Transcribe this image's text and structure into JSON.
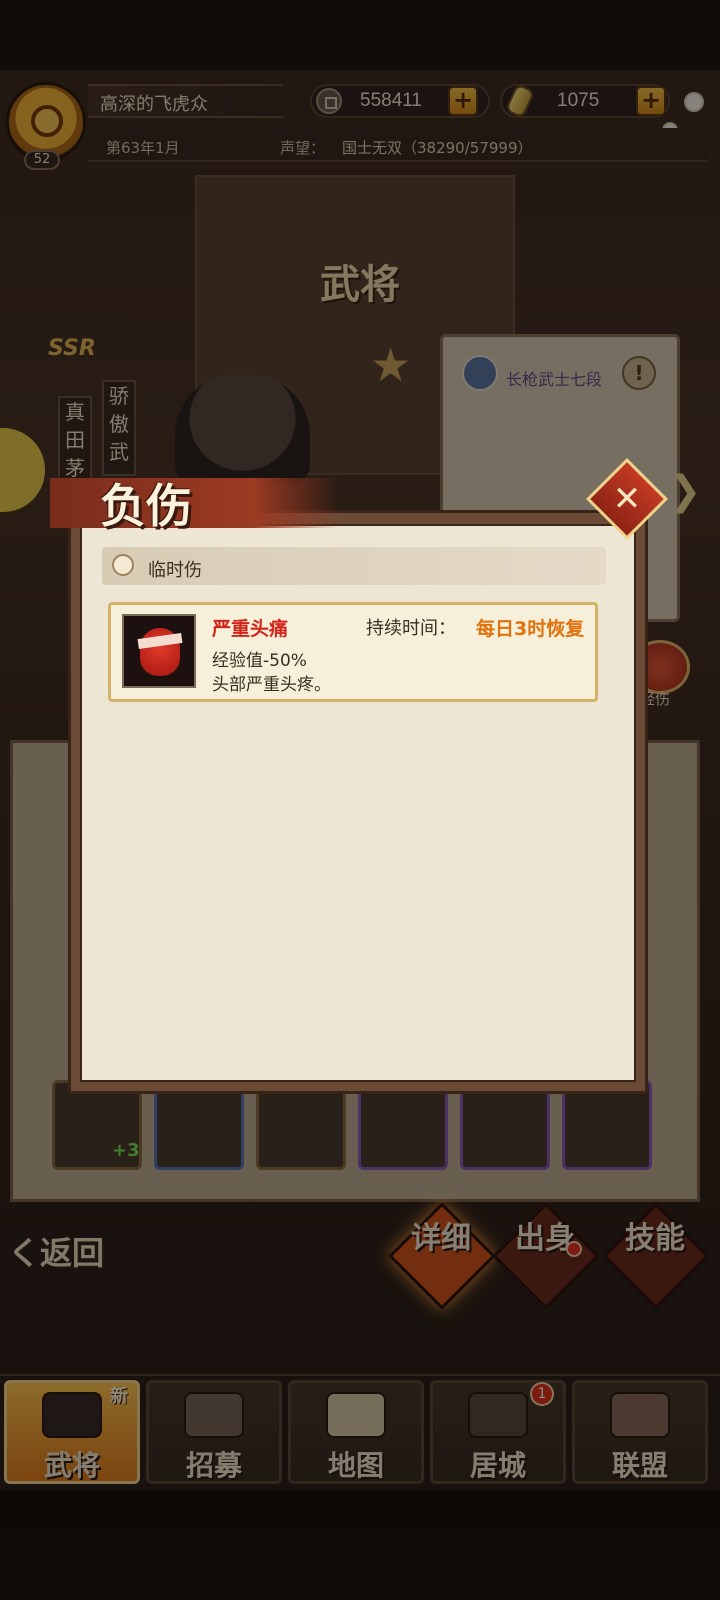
{
  "player": {
    "name": "高深的飞虎众",
    "level": "52",
    "date": "第63年1月",
    "reputation_label": "声望：",
    "reputation_value": "国士无双（38290/57999）"
  },
  "currency": {
    "coins": "558411",
    "gold": "1075",
    "plus": "+"
  },
  "page_title": "武将",
  "hero": {
    "rarity": "SSR",
    "name_vertical": "真田茅",
    "trait_vertical": "骄傲武",
    "unit_type": "长枪武士七段",
    "warning": "!",
    "status_label": "轻伤",
    "equip_bonus": "+3"
  },
  "actions": {
    "back": "く返回",
    "detail": "详细",
    "origin": "出身",
    "skill": "技能"
  },
  "nav": {
    "items": [
      {
        "label": "武将",
        "tag": "新"
      },
      {
        "label": "招募"
      },
      {
        "label": "地图"
      },
      {
        "label": "居城",
        "badge": "1"
      },
      {
        "label": "联盟"
      }
    ]
  },
  "modal": {
    "title": "负伤",
    "close": "✕",
    "section_title": "临时伤",
    "injury": {
      "name": "严重头痛",
      "duration_label": "持续时间：",
      "duration_value": "每日3时恢复",
      "effect": "经验值-50%",
      "description": "头部严重头疼。"
    }
  },
  "colors": {
    "accent_orange": "#e2720e",
    "injury_red": "#d2241a",
    "nav_active": "#e07b1c"
  }
}
